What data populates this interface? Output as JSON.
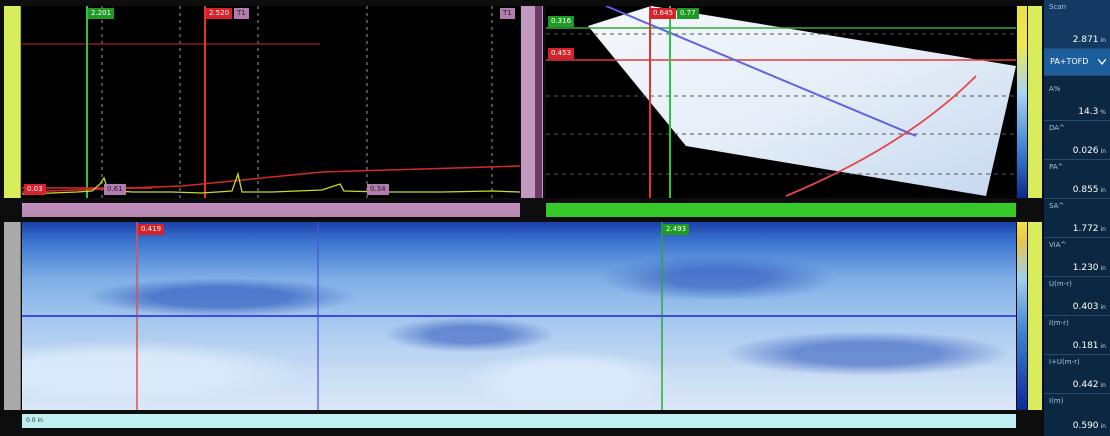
{
  "ascan": {
    "markers": {
      "green_ref": "2.201",
      "red_meas": "2.520",
      "t1_top": "T1",
      "t1_right": "T1",
      "gate_left": "0.03",
      "gate_mid": "0.61",
      "gate_right": "0.34"
    }
  },
  "sector": {
    "markers": {
      "top_green": "0.316",
      "top_red": "0.645",
      "top_green2": "0.77",
      "left_red": "0.453"
    }
  },
  "cscan": {
    "markers": {
      "red": "0.419",
      "green": "2.493"
    },
    "bottom_ruler_first": "0.0 in"
  },
  "readouts": {
    "scan": {
      "label": "Scan",
      "value": "2.871",
      "unit": "in"
    },
    "mode": {
      "label": "PA+TOFD"
    },
    "items": [
      {
        "label": "A%",
        "value": "14.3",
        "unit": "%"
      },
      {
        "label": "DA^",
        "value": "0.026",
        "unit": "in"
      },
      {
        "label": "PA^",
        "value": "0.855",
        "unit": "in"
      },
      {
        "label": "SA^",
        "value": "1.772",
        "unit": "in"
      },
      {
        "label": "ViA^",
        "value": "1.230",
        "unit": "in"
      },
      {
        "label": "U(m-r)",
        "value": "0.403",
        "unit": "in"
      },
      {
        "label": "I(m-r)",
        "value": "0.181",
        "unit": "in"
      },
      {
        "label": "I+U(m-r)",
        "value": "0.442",
        "unit": "in"
      },
      {
        "label": "I(m)",
        "value": "0.590",
        "unit": "in"
      }
    ]
  },
  "colors": {
    "accent_green": "#1f9a23",
    "accent_red": "#d6222a",
    "cursor_blue": "#3a4de0",
    "panel_blue": "#0c2742",
    "ruler_yellow": "#d8ec5c"
  }
}
